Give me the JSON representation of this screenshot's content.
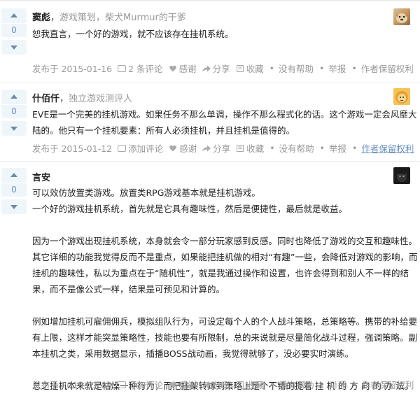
{
  "answers": [
    {
      "votes": "0",
      "name": "窦彪",
      "bio": "游戏策划，柴犬Murmur的干爹",
      "lines": [
        "恕我直言，一个好的游戏，就不应该存在挂机系统。"
      ],
      "meta": {
        "date": "发布于 2015-01-16",
        "comments": "2 条评论",
        "thanks": "感谢",
        "share": "分享",
        "favorite": "收藏",
        "unhelpful": "没有帮助",
        "report": "举报",
        "rights": "作者保留权利"
      }
    },
    {
      "votes": "0",
      "name": "什佰仟",
      "bio": "独立游戏测评人",
      "lines": [
        "EVE是一个完美的挂机游戏。如果任务不那么单调，操作不那么程式化的话。这个游戏一定会风靡大",
        "陆的。他只有一个挂机要素：所有人必须挂机，并且挂机是值得的。"
      ],
      "meta": {
        "date": "发布于 2015-01-12",
        "comments": "添加评论",
        "thanks": "感谢",
        "share": "分享",
        "favorite": "收藏",
        "unhelpful": "没有帮助",
        "report": "举报",
        "rights": "作者保留权利"
      }
    },
    {
      "votes": "0",
      "name": "言安",
      "bio": "",
      "lines": [
        "可以效仿放置类游戏。放置类RPG游戏基本就是挂机游戏。",
        "一个好的游戏挂机系统，首先就是它具有趣味性，然后是便捷性，最后就是收益。",
        "",
        "因为一个游戏出现挂机系统，本身就会令一部分玩家感到反感。同时也降低了游戏的交互和趣味性。",
        "其它详细的功能我觉得反而不是重点，如果能把挂机做的相对“有趣”一些，会降低对游戏的影响，而",
        "挂机的趣味性，私以为重点在于“随机性”，就是我通过操作和设置，也许会得到和别人不一样的结",
        "果，而不是像公式一样，结果是可预见和计算的。",
        "",
        "例如增加挂机可雇佣佣兵，模拟组队行为，可设定每个人的个人战斗策略，总策略等。携带的补给要",
        "有上限，这样才能突显策略性，技能也要有所限制，总的来说就是尽量简化战斗过程，强调策略。副",
        "本挂机之类，采用数据显示，插播BOSS战动画，我觉得就够了，没必要实时演练。",
        "",
        "总之挂机本来就是枯燥一种行为，而把挂架转嫁到策略上是个不错的提着 挂 机 的 方 向 的 办 法。"
      ],
      "meta": {
        "date": "发布于 2015-01-08",
        "comments": "添加评论",
        "thanks": "感谢",
        "share": "分享",
        "favorite": "收藏",
        "unhelpful": "没有帮助",
        "report": "举报",
        "rights": "作者保留权利"
      }
    }
  ],
  "colors": {
    "meta": "#999999",
    "vote_text": "#698ebf",
    "vote_bg": "#eff6fa",
    "link": "#698ebf"
  }
}
